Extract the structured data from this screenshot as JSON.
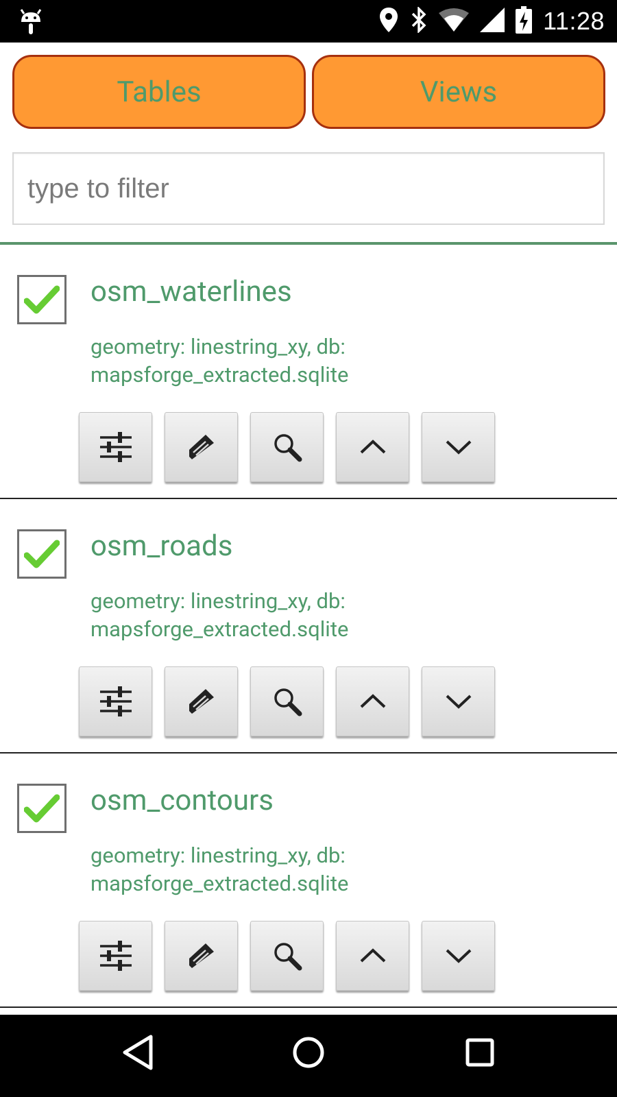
{
  "status_bar": {
    "time": "11:28",
    "icons": [
      "android-debug-icon",
      "location-pin-icon",
      "bluetooth-icon",
      "wifi-icon",
      "cellular-signal-icon",
      "battery-charging-icon"
    ]
  },
  "tabs": {
    "tables_label": "Tables",
    "views_label": "Views"
  },
  "filter": {
    "placeholder": "type to filter",
    "value": ""
  },
  "items": [
    {
      "name": "osm_waterlines",
      "description": "geometry: linestring_xy, db:\nmapsforge_extracted.sqlite",
      "checked": true
    },
    {
      "name": "osm_roads",
      "description": "geometry: linestring_xy, db:\nmapsforge_extracted.sqlite",
      "checked": true
    },
    {
      "name": "osm_contours",
      "description": "geometry: linestring_xy, db:\nmapsforge_extracted.sqlite",
      "checked": true
    }
  ],
  "item_actions": [
    "properties-sliders-icon",
    "edit-pencil-icon",
    "zoom-search-icon",
    "move-up-chevron-icon",
    "move-down-chevron-icon"
  ],
  "nav_bar": {
    "buttons": [
      "back-icon",
      "home-icon",
      "recents-icon"
    ]
  },
  "colors": {
    "accent_green": "#4f9a6b",
    "button_orange": "#ff9933",
    "button_border": "#a6300e",
    "check_green": "#66cc33"
  }
}
